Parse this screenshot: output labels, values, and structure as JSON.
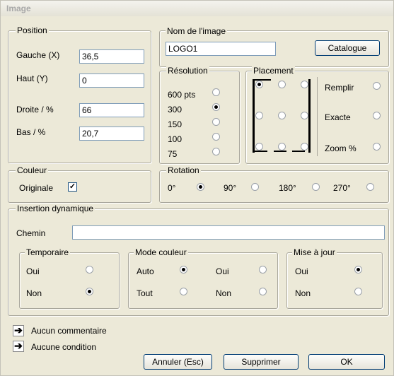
{
  "window": {
    "title": "Image"
  },
  "position": {
    "legend": "Position",
    "fields": [
      {
        "label": "Gauche (X)",
        "value": "36,5"
      },
      {
        "label": "Haut (Y)",
        "value": "0"
      },
      {
        "label": "Droite / %",
        "value": "66"
      },
      {
        "label": "Bas / %",
        "value": "20,7"
      }
    ]
  },
  "nom": {
    "legend": "Nom de l'image",
    "value": "LOGO1",
    "catalogue_label": "Catalogue"
  },
  "resolution": {
    "legend": "Résolution",
    "options": [
      "600 pts",
      "300",
      "150",
      "100",
      "75"
    ],
    "selected": "300"
  },
  "placement": {
    "legend": "Placement",
    "selected": "top-left",
    "options": [
      "Remplir",
      "Exacte",
      "Zoom %"
    ]
  },
  "couleur": {
    "legend": "Couleur",
    "label": "Originale",
    "checked": true,
    "check_glyph": "✓"
  },
  "rotation": {
    "legend": "Rotation",
    "options": [
      "0°",
      "90°",
      "180°",
      "270°"
    ],
    "selected": "0°"
  },
  "insertion": {
    "legend": "Insertion dynamique",
    "chemin_label": "Chemin",
    "chemin_value": "",
    "temporaire": {
      "legend": "Temporaire",
      "options": [
        "Oui",
        "Non"
      ],
      "selected": "Non"
    },
    "mode_couleur": {
      "legend": "Mode couleur",
      "options": [
        "Auto",
        "Oui",
        "Tout",
        "Non"
      ],
      "selected": "Auto"
    },
    "mise_a_jour": {
      "legend": "Mise à jour",
      "options": [
        "Oui",
        "Non"
      ],
      "selected": "Oui"
    }
  },
  "footer": {
    "commentaire": "Aucun commentaire",
    "condition": "Aucune condition",
    "arrow_glyph": "➔",
    "buttons": {
      "annuler": "Annuler (Esc)",
      "supprimer": "Supprimer",
      "ok": "OK"
    }
  }
}
